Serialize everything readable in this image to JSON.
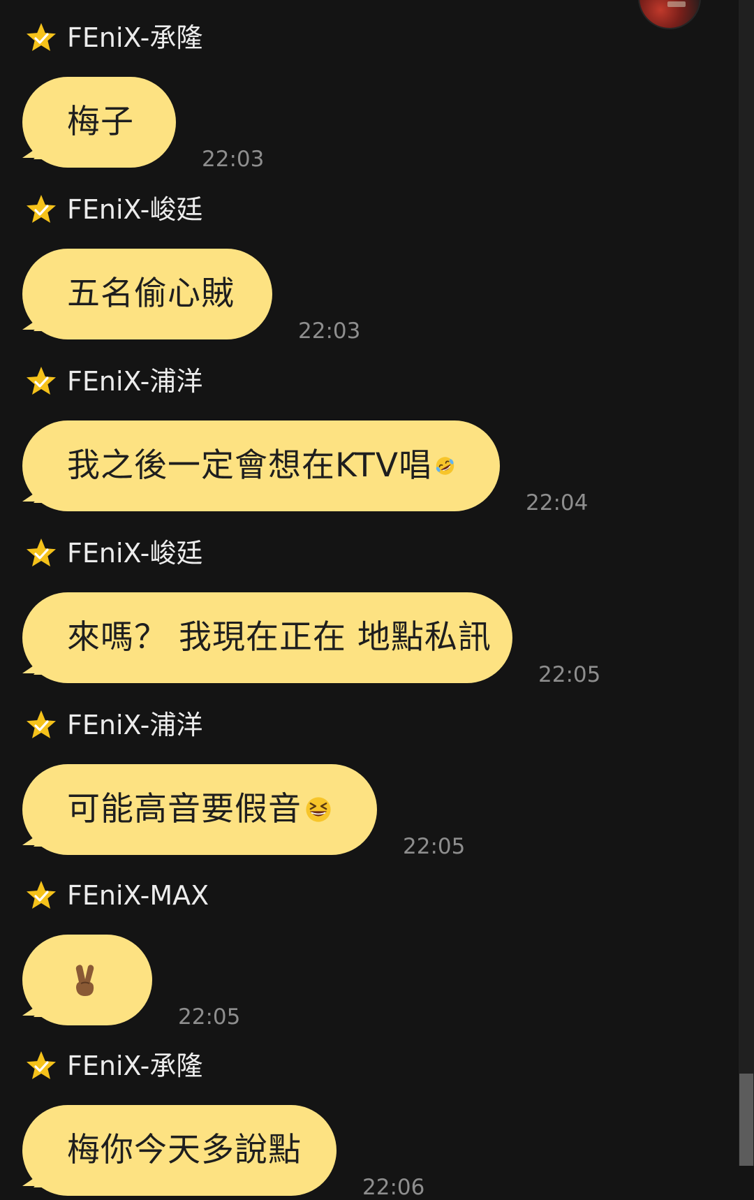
{
  "messages": [
    {
      "sender": "FEniX-承隆",
      "text": "梅子",
      "emoji": "",
      "time": "22:03"
    },
    {
      "sender": "FEniX-峻廷",
      "text": "五名偷心賊",
      "emoji": "",
      "time": "22:03"
    },
    {
      "sender": "FEniX-浦洋",
      "text": "我之後一定會想在KTV唱",
      "emoji": "rolling-on-floor-laughing",
      "time": "22:04"
    },
    {
      "sender": "FEniX-峻廷",
      "text": "來嗎？ 我現在正在 地點私訊",
      "emoji": "",
      "time": "22:05"
    },
    {
      "sender": "FEniX-浦洋",
      "text": "可能高音要假音",
      "emoji": "grinning-squinting",
      "time": "22:05"
    },
    {
      "sender": "FEniX-MAX",
      "text": "",
      "emoji": "victory-hand",
      "time": "22:05"
    },
    {
      "sender": "FEniX-承隆",
      "text": "梅你今天多說點",
      "emoji": "",
      "time": "22:06"
    }
  ],
  "colors": {
    "background": "#141414",
    "bubble": "#fde282",
    "star": "#f5c21b",
    "sender_text": "#ececec",
    "time_text": "#8e8e8e"
  }
}
